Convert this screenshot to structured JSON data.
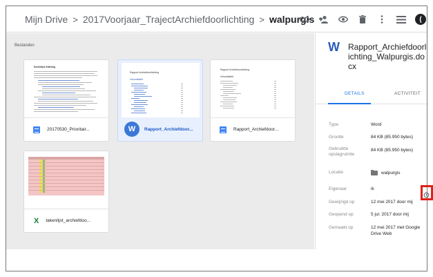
{
  "header": {
    "breadcrumb": [
      "Mijn Drive",
      "2017Voorjaar_TrajectArchiefdoorlichting",
      "walpurgis"
    ],
    "separator": ">",
    "account_initial": "("
  },
  "files": {
    "section_label": "Bestanden",
    "cards": [
      {
        "name": "20170530_Prioritair...",
        "type": "doc-icon",
        "thumb_heading": "Sectielijst Afdeling"
      },
      {
        "name": "Rapport_Archiefdoor...",
        "type": "word-icon",
        "selected": true,
        "thumb_heading": "Rapport Archiefdoorlichting",
        "thumb_sub": "Inhoudstafel"
      },
      {
        "name": "Rapport_Archiefdoor...",
        "type": "doc-icon",
        "thumb_heading": "Rapport Archiefdoorlichting",
        "thumb_sub": "Inhoudstafel"
      },
      {
        "name": "takenlijst_archiefdoo...",
        "type": "sheets-icon"
      }
    ]
  },
  "panel": {
    "title": "Rapport_Archiefdoorlichting_Walpurgis.docx",
    "tabs": {
      "details": "DETAILS",
      "activity": "ACTIVITEIT"
    },
    "properties": [
      {
        "label": "Type",
        "value": "Word"
      },
      {
        "label": "Grootte",
        "value": "84 KB (85.950 bytes)"
      },
      {
        "label": "Gebruikte opslagruimte",
        "value": "84 KB (85.950 bytes)"
      },
      {
        "label": "Locatie",
        "value": "walpurgis"
      },
      {
        "label": "Eigenaar",
        "value": "ik"
      },
      {
        "label": "Gewijzigd op",
        "value": "12 mei 2017 door mij"
      },
      {
        "label": "Geopend op",
        "value": "5 jul. 2017 door mij"
      },
      {
        "label": "Gemaakt op",
        "value": "12 mei 2017 met Google Drive Web"
      }
    ]
  },
  "colors": {
    "accent": "#1a73e8",
    "highlight_box": "#e0201b",
    "selected_card": "#e8f0fe",
    "files_bg": "#ebebeb"
  }
}
